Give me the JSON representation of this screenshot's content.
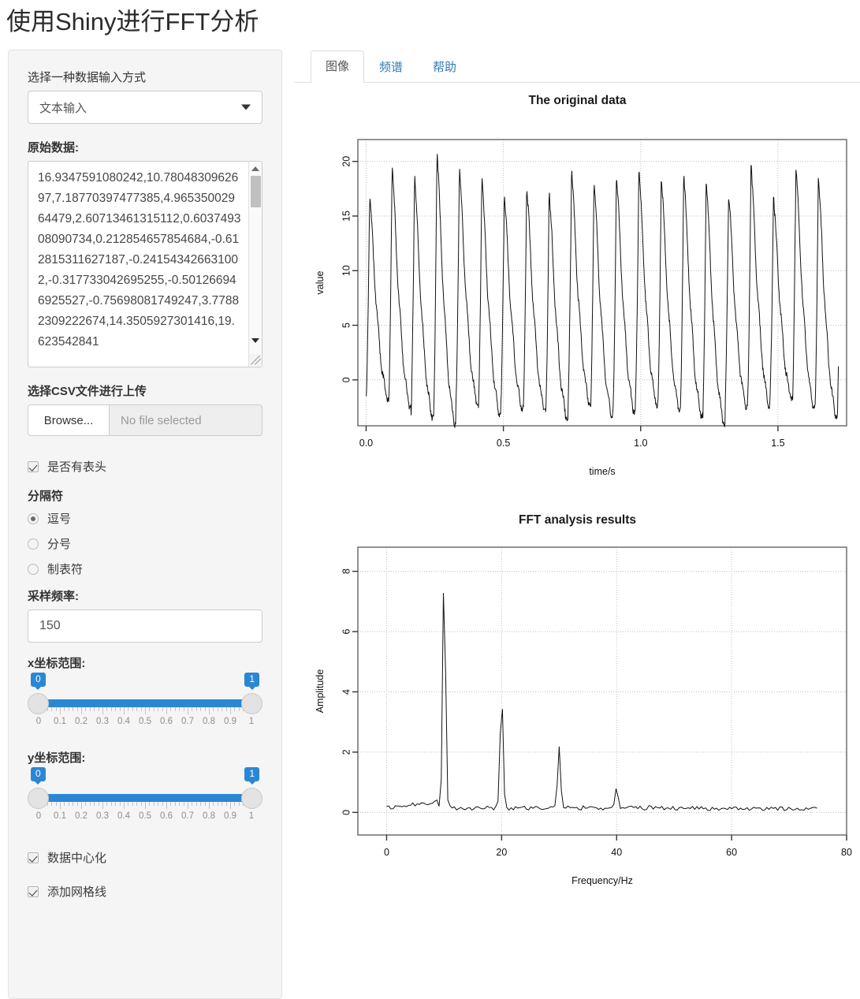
{
  "app": {
    "title": "使用Shiny进行FFT分析"
  },
  "sidebar": {
    "input_mode": {
      "label": "选择一种数据输入方式",
      "value": "文本输入",
      "caret_icon": "chevron-down-icon"
    },
    "raw_data": {
      "label": "原始数据:",
      "value": "16.9347591080242,10.7804830962697,7.18770397477385,4.96535002964479,2.60713461315112,0.603749308090734,0.212854657854684,-0.612815311627187,-0.241543426631002,-0.317733042695255,-0.501266946925527,-0.75698081749247,3.77882309222674,14.3505927301416,19.623542841"
    },
    "csv_upload": {
      "label": "选择CSV文件进行上传",
      "browse_label": "Browse...",
      "file_status": "No file selected"
    },
    "header_checkbox": {
      "label": "是否有表头",
      "checked": true
    },
    "separator": {
      "title": "分隔符",
      "options": [
        {
          "label": "逗号",
          "selected": true
        },
        {
          "label": "分号",
          "selected": false
        },
        {
          "label": "制表符",
          "selected": false
        }
      ]
    },
    "sample_rate": {
      "label": "采样频率:",
      "value": "150"
    },
    "x_range": {
      "label": "x坐标范围:",
      "min_value": "0",
      "max_value": "1",
      "ticks": [
        "0",
        "0.1",
        "0.2",
        "0.3",
        "0.4",
        "0.5",
        "0.6",
        "0.7",
        "0.8",
        "0.9",
        "1"
      ]
    },
    "y_range": {
      "label": "y坐标范围:",
      "min_value": "0",
      "max_value": "1",
      "ticks": [
        "0",
        "0.1",
        "0.2",
        "0.3",
        "0.4",
        "0.5",
        "0.6",
        "0.7",
        "0.8",
        "0.9",
        "1"
      ]
    },
    "center_data": {
      "label": "数据中心化",
      "checked": true
    },
    "add_grid": {
      "label": "添加网格线",
      "checked": true
    },
    "accent_color": "#2b87d4",
    "panel_bg": "#f5f5f5"
  },
  "main": {
    "tabs": [
      {
        "label": "图像",
        "active": true
      },
      {
        "label": "频谱",
        "active": false
      },
      {
        "label": "帮助",
        "active": false
      }
    ]
  },
  "chart_data": [
    {
      "type": "line",
      "title": "The original data",
      "xlabel": "time/s",
      "ylabel": "value",
      "xlim": [
        -0.03,
        1.75
      ],
      "ylim": [
        -4.2,
        22.0
      ],
      "xticks": [
        0.0,
        0.5,
        1.0,
        1.5
      ],
      "xtick_labels": [
        "0.0",
        "0.5",
        "1.0",
        "1.5"
      ],
      "yticks": [
        0,
        5,
        10,
        15,
        20
      ],
      "ytick_labels": [
        "0",
        "5",
        "10",
        "15",
        "20"
      ],
      "grid": true,
      "series": [
        {
          "name": "value",
          "description": "Sharp periodic sawtooth-like pulses, ~21 cycles over 1.7 s (~12 Hz), peaks 17-21, troughs -1 to -4",
          "period": 0.0817,
          "n_cycles": 21,
          "peaks": [
            16.9,
            19.7,
            18.8,
            21.0,
            19.5,
            18.7,
            17.1,
            17.8,
            17.3,
            19.4,
            18.3,
            19.0,
            19.5,
            18.6,
            19.0,
            18.4,
            17.1,
            19.9
          ],
          "troughs": [
            -1.6,
            -2.4,
            -3.3,
            -3.9,
            -2.1,
            -3.1,
            -2.6,
            -2.7,
            -3.5,
            -2.1,
            -3.2,
            -2.9,
            -2.2,
            -2.6,
            -3.2,
            -3.9,
            -2.4,
            -2.2
          ]
        }
      ]
    },
    {
      "type": "line",
      "title": "FFT analysis results",
      "xlabel": "Frequency/Hz",
      "ylabel": "Amplitude",
      "xlim": [
        -5,
        80
      ],
      "ylim": [
        -0.75,
        8.8
      ],
      "xticks": [
        0,
        20,
        40,
        60,
        80
      ],
      "xtick_labels": [
        "0",
        "20",
        "40",
        "60",
        "80"
      ],
      "yticks": [
        0,
        2,
        4,
        6,
        8
      ],
      "ytick_labels": [
        "0",
        "2",
        "4",
        "6",
        "8"
      ],
      "grid": true,
      "series": [
        {
          "name": "Amplitude",
          "description": "Spectrum with harmonic peaks at 10, 20, 30 and 40 Hz and low noise floor elsewhere",
          "peaks": [
            {
              "frequency": 10,
              "amplitude": 8.0
            },
            {
              "frequency": 20,
              "amplitude": 3.9
            },
            {
              "frequency": 30,
              "amplitude": 2.0
            },
            {
              "frequency": 40,
              "amplitude": 0.75
            }
          ],
          "noise_floor": 0.15,
          "x_end": 75
        }
      ]
    }
  ]
}
